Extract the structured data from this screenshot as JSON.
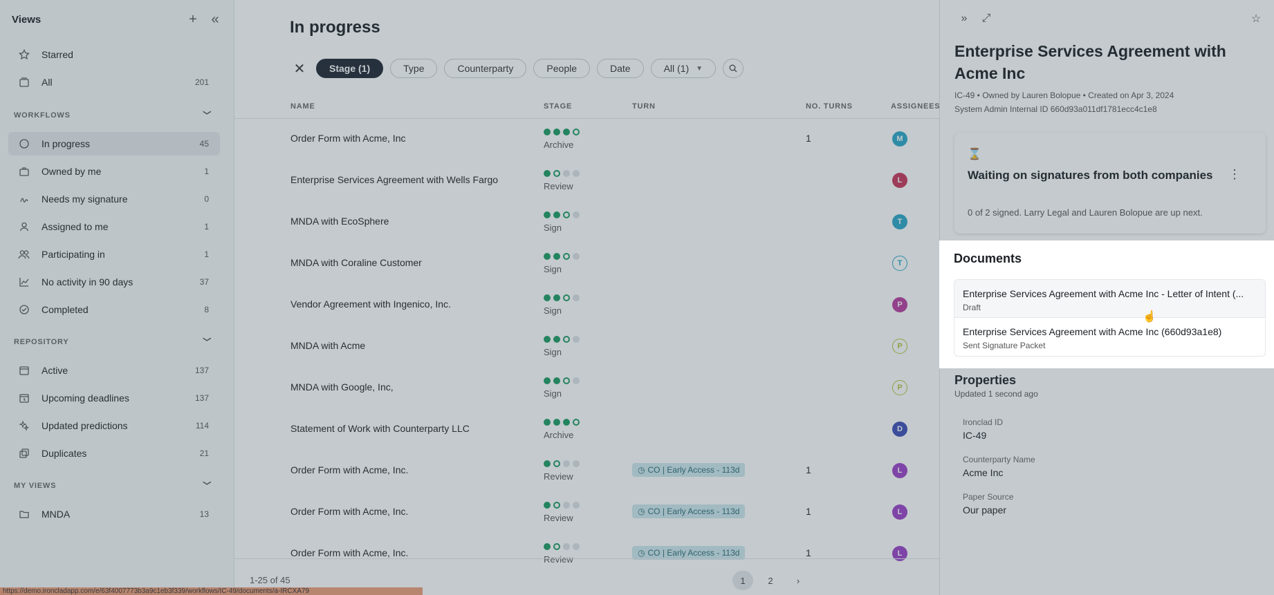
{
  "sidebar": {
    "title": "Views",
    "items_top": [
      {
        "label": "Starred",
        "count": ""
      },
      {
        "label": "All",
        "count": "201"
      }
    ],
    "workflows_title": "WORKFLOWS",
    "workflows": [
      {
        "label": "In progress",
        "count": "45"
      },
      {
        "label": "Owned by me",
        "count": "1"
      },
      {
        "label": "Needs my signature",
        "count": "0"
      },
      {
        "label": "Assigned to me",
        "count": "1"
      },
      {
        "label": "Participating in",
        "count": "1"
      },
      {
        "label": "No activity in 90 days",
        "count": "37"
      },
      {
        "label": "Completed",
        "count": "8"
      }
    ],
    "repository_title": "REPOSITORY",
    "repository": [
      {
        "label": "Active",
        "count": "137"
      },
      {
        "label": "Upcoming deadlines",
        "count": "137"
      },
      {
        "label": "Updated predictions",
        "count": "114"
      },
      {
        "label": "Duplicates",
        "count": "21"
      }
    ],
    "myviews_title": "MY VIEWS",
    "myviews": [
      {
        "label": "MNDA",
        "count": "13"
      }
    ]
  },
  "main": {
    "title": "In progress",
    "filters": [
      "Stage (1)",
      "Type",
      "Counterparty",
      "People",
      "Date",
      "All (1)"
    ],
    "columns": {
      "name": "NAME",
      "stage": "STAGE",
      "turn": "TURN",
      "turns": "NO. TURNS",
      "assignees": "ASSIGNEES"
    },
    "rows": [
      {
        "name": "Order Form with Acme, Inc",
        "stage": "Archive",
        "turn": "",
        "turns": "1",
        "initial": "M"
      },
      {
        "name": "Enterprise Services Agreement with Wells Fargo",
        "stage": "Review",
        "turn": "",
        "turns": "",
        "initial": "L"
      },
      {
        "name": "MNDA with EcoSphere",
        "stage": "Sign",
        "turn": "",
        "turns": "",
        "initial": "T"
      },
      {
        "name": "MNDA with Coraline Customer",
        "stage": "Sign",
        "turn": "",
        "turns": "",
        "initial": "T"
      },
      {
        "name": "Vendor Agreement with Ingenico, Inc.",
        "stage": "Sign",
        "turn": "",
        "turns": "",
        "initial": "P"
      },
      {
        "name": "MNDA with Acme",
        "stage": "Sign",
        "turn": "",
        "turns": "",
        "initial": "P"
      },
      {
        "name": "MNDA with Google, Inc,",
        "stage": "Sign",
        "turn": "",
        "turns": "",
        "initial": "P"
      },
      {
        "name": "Statement of Work with Counterparty LLC",
        "stage": "Archive",
        "turn": "",
        "turns": "",
        "initial": "D"
      },
      {
        "name": "Order Form with Acme, Inc.",
        "stage": "Review",
        "turn": "CO | Early Access - 113d",
        "turns": "1",
        "initial": "L"
      },
      {
        "name": "Order Form with Acme, Inc.",
        "stage": "Review",
        "turn": "CO | Early Access - 113d",
        "turns": "1",
        "initial": "L"
      },
      {
        "name": "Order Form with Acme, Inc.",
        "stage": "Review",
        "turn": "CO | Early Access - 113d",
        "turns": "1",
        "initial": "L"
      }
    ],
    "pager_info": "1-25 of 45",
    "pages": [
      "1",
      "2"
    ],
    "status_url": "https://demo.ironcladapp.com/e/63f4007773b3a9c1eb3f339/workflows/IC-49/documents/a-IRCXA79"
  },
  "panel": {
    "title": "Enterprise Services Agreement with Acme Inc",
    "meta": "IC-49  •  Owned by Lauren Bolopue  •  Created on Apr 3, 2024",
    "system_id": "System Admin Internal ID 660d93a011df1781ecc4c1e8",
    "wait_title": "Waiting on signatures from both companies",
    "wait_sub": "0 of 2 signed. Larry Legal and Lauren Bolopue are up next.",
    "documents_title": "Documents",
    "documents": [
      {
        "name": "Enterprise Services Agreement with Acme Inc - Letter of Intent (...",
        "status": "Draft"
      },
      {
        "name": "Enterprise Services Agreement with Acme Inc (660d93a1e8)",
        "status": "Sent Signature Packet"
      }
    ],
    "properties_title": "Properties",
    "properties_sub": "Updated 1 second ago",
    "properties": [
      {
        "label": "Ironclad ID",
        "value": "IC-49"
      },
      {
        "label": "Counterparty Name",
        "value": "Acme Inc"
      },
      {
        "label": "Paper Source",
        "value": "Our paper"
      }
    ]
  }
}
